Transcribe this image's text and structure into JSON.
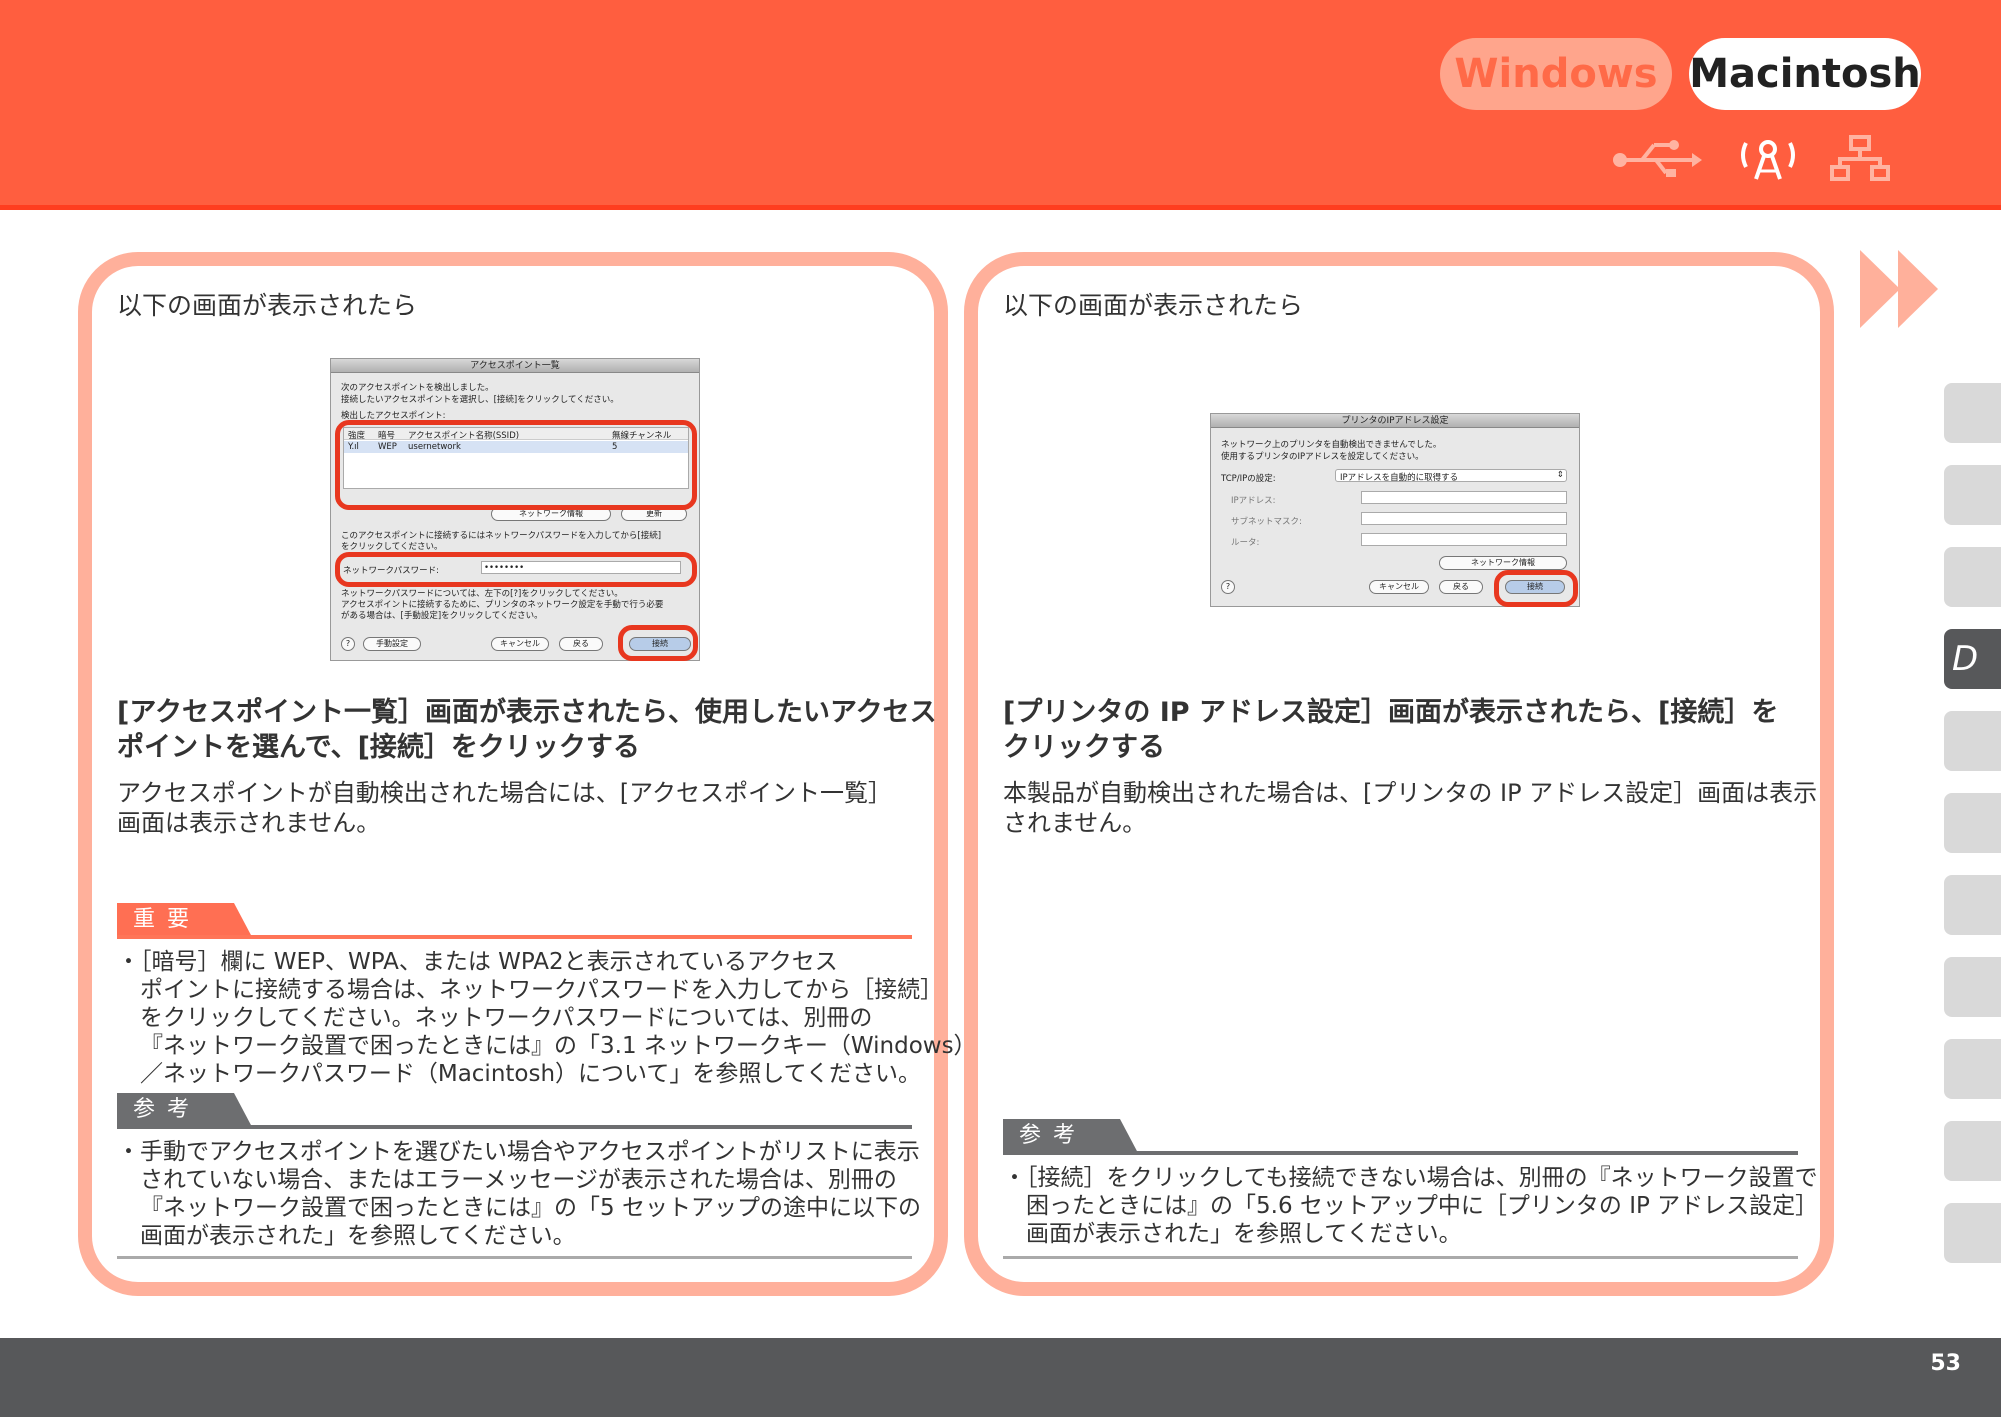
{
  "header": {
    "tab_windows": "Windows",
    "tab_macintosh": "Macintosh",
    "icons": [
      "usb-icon",
      "wireless-icon",
      "wired-network-icon"
    ]
  },
  "left": {
    "intro": "以下の画面が表示されたら",
    "dialog": {
      "title": "アクセスポイント一覧",
      "line1": "次のアクセスポイントを検出しました。",
      "line2": "接続したいアクセスポイントを選択し、[接続]をクリックしてください。",
      "list_label": "検出したアクセスポイント:",
      "col_strength": "強度",
      "col_encryption": "暗号",
      "col_ssid": "アクセスポイント名称(SSID)",
      "col_channel": "無線チャンネル",
      "row_encryption": "WEP",
      "row_ssid": "usernetwork",
      "row_channel": "5",
      "btn_network_info": "ネットワーク情報",
      "btn_refresh": "更新",
      "msg1": "このアクセスポイントに接続するにはネットワークパスワードを入力してから[接続]",
      "msg2": "をクリックしてください。",
      "password_label": "ネットワークパスワード:",
      "password_value": "••••••••",
      "msg3": "ネットワークパスワードについては、左下の[?]をクリックしてください。",
      "msg4": "アクセスポイントに接続するために、プリンタのネットワーク設定を手動で行う必要",
      "msg5": "がある場合は、[手動設定]をクリックしてください。",
      "btn_help": "?",
      "btn_manual": "手動設定",
      "btn_cancel": "キャンセル",
      "btn_back": "戻る",
      "btn_connect": "接続"
    },
    "heading": "[アクセスポイント一覧］画面が表示されたら、使用したいアクセスポイントを選んで、[接続］をクリックする",
    "heading_l1": "[アクセスポイント一覧］画面が表示されたら、使用したいアクセス",
    "heading_l2": "ポイントを選んで、[接続］をクリックする",
    "body_l1": "アクセスポイントが自動検出された場合には、[アクセスポイント一覧］",
    "body_l2": "画面は表示されません。",
    "important_label": "重要",
    "important_l1": "・［暗号］欄に WEP、WPA、または WPA2と表示されているアクセス",
    "important_l2": "ポイントに接続する場合は、ネットワークパスワードを入力してから［接続］",
    "important_l3": "をクリックしてください。ネットワークパスワードについては、別冊の",
    "important_l4": "『ネットワーク設置で困ったときには』の「3.1 ネットワークキー（Windows）",
    "important_l5": "／ネットワークパスワード（Macintosh）について」を参照してください。",
    "ref_label": "参考",
    "ref_l1": "・手動でアクセスポイントを選びたい場合やアクセスポイントがリストに表示",
    "ref_l2": "されていない場合、またはエラーメッセージが表示された場合は、別冊の",
    "ref_l3": "『ネットワーク設置で困ったときには』の「5 セットアップの途中に以下の",
    "ref_l4": "画面が表示された」を参照してください。"
  },
  "right": {
    "intro": "以下の画面が表示されたら",
    "dialog": {
      "title": "プリンタのIPアドレス設定",
      "line1": "ネットワーク上のプリンタを自動検出できませんでした。",
      "line2": "使用するプリンタのIPアドレスを設定してください。",
      "tcpip_label": "TCP/IPの設定:",
      "tcpip_value": "IPアドレスを自動的に取得する",
      "ip_label": "IPアドレス:",
      "subnet_label": "サブネットマスク:",
      "router_label": "ルータ:",
      "btn_network_info": "ネットワーク情報",
      "btn_help": "?",
      "btn_cancel": "キャンセル",
      "btn_back": "戻る",
      "btn_connect": "接続"
    },
    "heading_l1": "[プリンタの IP アドレス設定］画面が表示されたら、[接続］を",
    "heading_l2": "クリックする",
    "body_l1": "本製品が自動検出された場合は、[プリンタの IP アドレス設定］画面は表示",
    "body_l2": "されません。",
    "ref_label": "参考",
    "ref_l1": "・［接続］をクリックしても接続できない場合は、別冊の『ネットワーク設置で",
    "ref_l2": "困ったときには』の「5.6 セットアップ中に［プリンタの IP アドレス設定］",
    "ref_l3": "画面が表示された」を参照してください。"
  },
  "sidebar": {
    "active_tab": "D"
  },
  "footer": {
    "page_number": "53"
  },
  "colors": {
    "header": "#ff5e3f",
    "panel_border": "#ffb09b",
    "accent": "#ff6f53",
    "footer": "#57585a"
  }
}
